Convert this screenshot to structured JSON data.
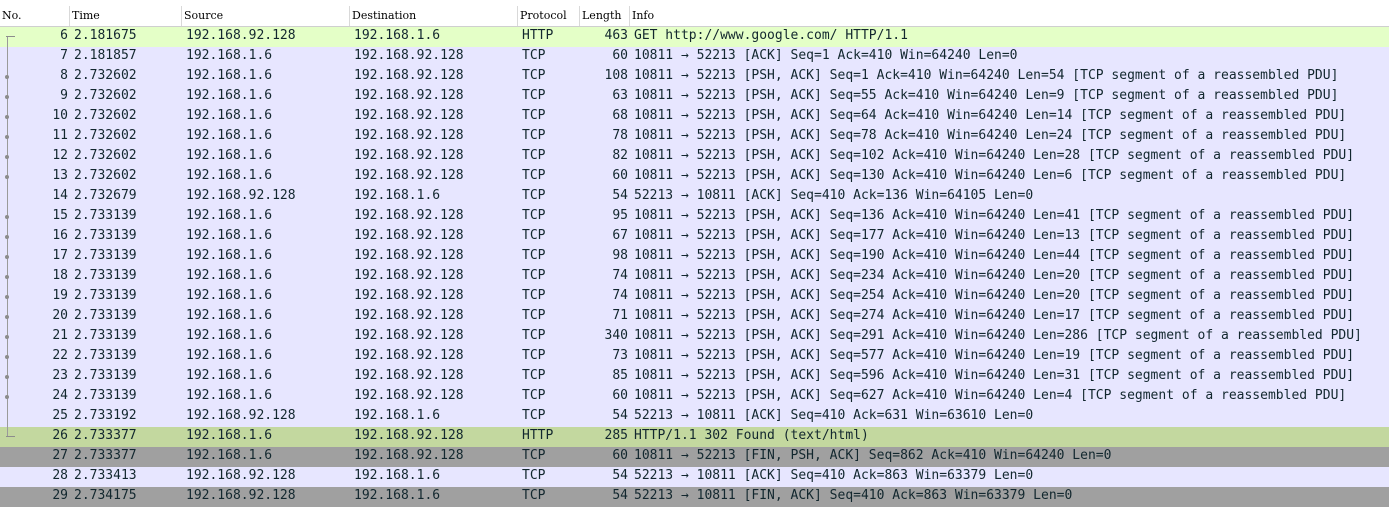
{
  "columns": {
    "no": "No.",
    "time": "Time",
    "source": "Source",
    "destination": "Destination",
    "protocol": "Protocol",
    "length": "Length",
    "info": "Info"
  },
  "packets": [
    {
      "no": "6",
      "time": "2.181675",
      "source": "192.168.92.128",
      "destination": "192.168.1.6",
      "protocol": "HTTP",
      "length": "463",
      "info": "GET http://www.google.com/ HTTP/1.1",
      "style": "http",
      "marker": "request"
    },
    {
      "no": "7",
      "time": "2.181857",
      "source": "192.168.1.6",
      "destination": "192.168.92.128",
      "protocol": "TCP",
      "length": "60",
      "info": "10811 → 52213 [ACK] Seq=1 Ack=410 Win=64240 Len=0",
      "style": "tcp",
      "marker": "line"
    },
    {
      "no": "8",
      "time": "2.732602",
      "source": "192.168.1.6",
      "destination": "192.168.92.128",
      "protocol": "TCP",
      "length": "108",
      "info": "10811 → 52213 [PSH, ACK] Seq=1 Ack=410 Win=64240 Len=54 [TCP segment of a reassembled PDU]",
      "style": "tcp",
      "marker": "dot"
    },
    {
      "no": "9",
      "time": "2.732602",
      "source": "192.168.1.6",
      "destination": "192.168.92.128",
      "protocol": "TCP",
      "length": "63",
      "info": "10811 → 52213 [PSH, ACK] Seq=55 Ack=410 Win=64240 Len=9 [TCP segment of a reassembled PDU]",
      "style": "tcp",
      "marker": "dot"
    },
    {
      "no": "10",
      "time": "2.732602",
      "source": "192.168.1.6",
      "destination": "192.168.92.128",
      "protocol": "TCP",
      "length": "68",
      "info": "10811 → 52213 [PSH, ACK] Seq=64 Ack=410 Win=64240 Len=14 [TCP segment of a reassembled PDU]",
      "style": "tcp",
      "marker": "dot"
    },
    {
      "no": "11",
      "time": "2.732602",
      "source": "192.168.1.6",
      "destination": "192.168.92.128",
      "protocol": "TCP",
      "length": "78",
      "info": "10811 → 52213 [PSH, ACK] Seq=78 Ack=410 Win=64240 Len=24 [TCP segment of a reassembled PDU]",
      "style": "tcp",
      "marker": "dot"
    },
    {
      "no": "12",
      "time": "2.732602",
      "source": "192.168.1.6",
      "destination": "192.168.92.128",
      "protocol": "TCP",
      "length": "82",
      "info": "10811 → 52213 [PSH, ACK] Seq=102 Ack=410 Win=64240 Len=28 [TCP segment of a reassembled PDU]",
      "style": "tcp",
      "marker": "dot"
    },
    {
      "no": "13",
      "time": "2.732602",
      "source": "192.168.1.6",
      "destination": "192.168.92.128",
      "protocol": "TCP",
      "length": "60",
      "info": "10811 → 52213 [PSH, ACK] Seq=130 Ack=410 Win=64240 Len=6 [TCP segment of a reassembled PDU]",
      "style": "tcp",
      "marker": "dot"
    },
    {
      "no": "14",
      "time": "2.732679",
      "source": "192.168.92.128",
      "destination": "192.168.1.6",
      "protocol": "TCP",
      "length": "54",
      "info": "52213 → 10811 [ACK] Seq=410 Ack=136 Win=64105 Len=0",
      "style": "tcp",
      "marker": "line"
    },
    {
      "no": "15",
      "time": "2.733139",
      "source": "192.168.1.6",
      "destination": "192.168.92.128",
      "protocol": "TCP",
      "length": "95",
      "info": "10811 → 52213 [PSH, ACK] Seq=136 Ack=410 Win=64240 Len=41 [TCP segment of a reassembled PDU]",
      "style": "tcp",
      "marker": "dot"
    },
    {
      "no": "16",
      "time": "2.733139",
      "source": "192.168.1.6",
      "destination": "192.168.92.128",
      "protocol": "TCP",
      "length": "67",
      "info": "10811 → 52213 [PSH, ACK] Seq=177 Ack=410 Win=64240 Len=13 [TCP segment of a reassembled PDU]",
      "style": "tcp",
      "marker": "dot"
    },
    {
      "no": "17",
      "time": "2.733139",
      "source": "192.168.1.6",
      "destination": "192.168.92.128",
      "protocol": "TCP",
      "length": "98",
      "info": "10811 → 52213 [PSH, ACK] Seq=190 Ack=410 Win=64240 Len=44 [TCP segment of a reassembled PDU]",
      "style": "tcp",
      "marker": "dot"
    },
    {
      "no": "18",
      "time": "2.733139",
      "source": "192.168.1.6",
      "destination": "192.168.92.128",
      "protocol": "TCP",
      "length": "74",
      "info": "10811 → 52213 [PSH, ACK] Seq=234 Ack=410 Win=64240 Len=20 [TCP segment of a reassembled PDU]",
      "style": "tcp",
      "marker": "dot"
    },
    {
      "no": "19",
      "time": "2.733139",
      "source": "192.168.1.6",
      "destination": "192.168.92.128",
      "protocol": "TCP",
      "length": "74",
      "info": "10811 → 52213 [PSH, ACK] Seq=254 Ack=410 Win=64240 Len=20 [TCP segment of a reassembled PDU]",
      "style": "tcp",
      "marker": "dot"
    },
    {
      "no": "20",
      "time": "2.733139",
      "source": "192.168.1.6",
      "destination": "192.168.92.128",
      "protocol": "TCP",
      "length": "71",
      "info": "10811 → 52213 [PSH, ACK] Seq=274 Ack=410 Win=64240 Len=17 [TCP segment of a reassembled PDU]",
      "style": "tcp",
      "marker": "dot"
    },
    {
      "no": "21",
      "time": "2.733139",
      "source": "192.168.1.6",
      "destination": "192.168.92.128",
      "protocol": "TCP",
      "length": "340",
      "info": "10811 → 52213 [PSH, ACK] Seq=291 Ack=410 Win=64240 Len=286 [TCP segment of a reassembled PDU]",
      "style": "tcp",
      "marker": "dot"
    },
    {
      "no": "22",
      "time": "2.733139",
      "source": "192.168.1.6",
      "destination": "192.168.92.128",
      "protocol": "TCP",
      "length": "73",
      "info": "10811 → 52213 [PSH, ACK] Seq=577 Ack=410 Win=64240 Len=19 [TCP segment of a reassembled PDU]",
      "style": "tcp",
      "marker": "dot"
    },
    {
      "no": "23",
      "time": "2.733139",
      "source": "192.168.1.6",
      "destination": "192.168.92.128",
      "protocol": "TCP",
      "length": "85",
      "info": "10811 → 52213 [PSH, ACK] Seq=596 Ack=410 Win=64240 Len=31 [TCP segment of a reassembled PDU]",
      "style": "tcp",
      "marker": "dot"
    },
    {
      "no": "24",
      "time": "2.733139",
      "source": "192.168.1.6",
      "destination": "192.168.92.128",
      "protocol": "TCP",
      "length": "60",
      "info": "10811 → 52213 [PSH, ACK] Seq=627 Ack=410 Win=64240 Len=4 [TCP segment of a reassembled PDU]",
      "style": "tcp",
      "marker": "dot"
    },
    {
      "no": "25",
      "time": "2.733192",
      "source": "192.168.92.128",
      "destination": "192.168.1.6",
      "protocol": "TCP",
      "length": "54",
      "info": "52213 → 10811 [ACK] Seq=410 Ack=631 Win=63610 Len=0",
      "style": "tcp",
      "marker": "line"
    },
    {
      "no": "26",
      "time": "2.733377",
      "source": "192.168.1.6",
      "destination": "192.168.92.128",
      "protocol": "HTTP",
      "length": "285",
      "info": "HTTP/1.1 302 Found  (text/html)",
      "style": "sel-http",
      "marker": "response"
    },
    {
      "no": "27",
      "time": "2.733377",
      "source": "192.168.1.6",
      "destination": "192.168.92.128",
      "protocol": "TCP",
      "length": "60",
      "info": "10811 → 52213 [FIN, PSH, ACK] Seq=862 Ack=410 Win=64240 Len=0",
      "style": "fin",
      "marker": "none"
    },
    {
      "no": "28",
      "time": "2.733413",
      "source": "192.168.92.128",
      "destination": "192.168.1.6",
      "protocol": "TCP",
      "length": "54",
      "info": "52213 → 10811 [ACK] Seq=410 Ack=863 Win=63379 Len=0",
      "style": "tcp",
      "marker": "none"
    },
    {
      "no": "29",
      "time": "2.734175",
      "source": "192.168.92.128",
      "destination": "192.168.1.6",
      "protocol": "TCP",
      "length": "54",
      "info": "52213 → 10811 [FIN, ACK] Seq=410 Ack=863 Win=63379 Len=0",
      "style": "fin",
      "marker": "none"
    }
  ],
  "colors": {
    "tcp_row": "#e7e6ff",
    "http_row": "#e4ffc7",
    "selected_http_row": "#c3d89f",
    "fin_row": "#a0a0a0",
    "row_text": "#12272e"
  }
}
